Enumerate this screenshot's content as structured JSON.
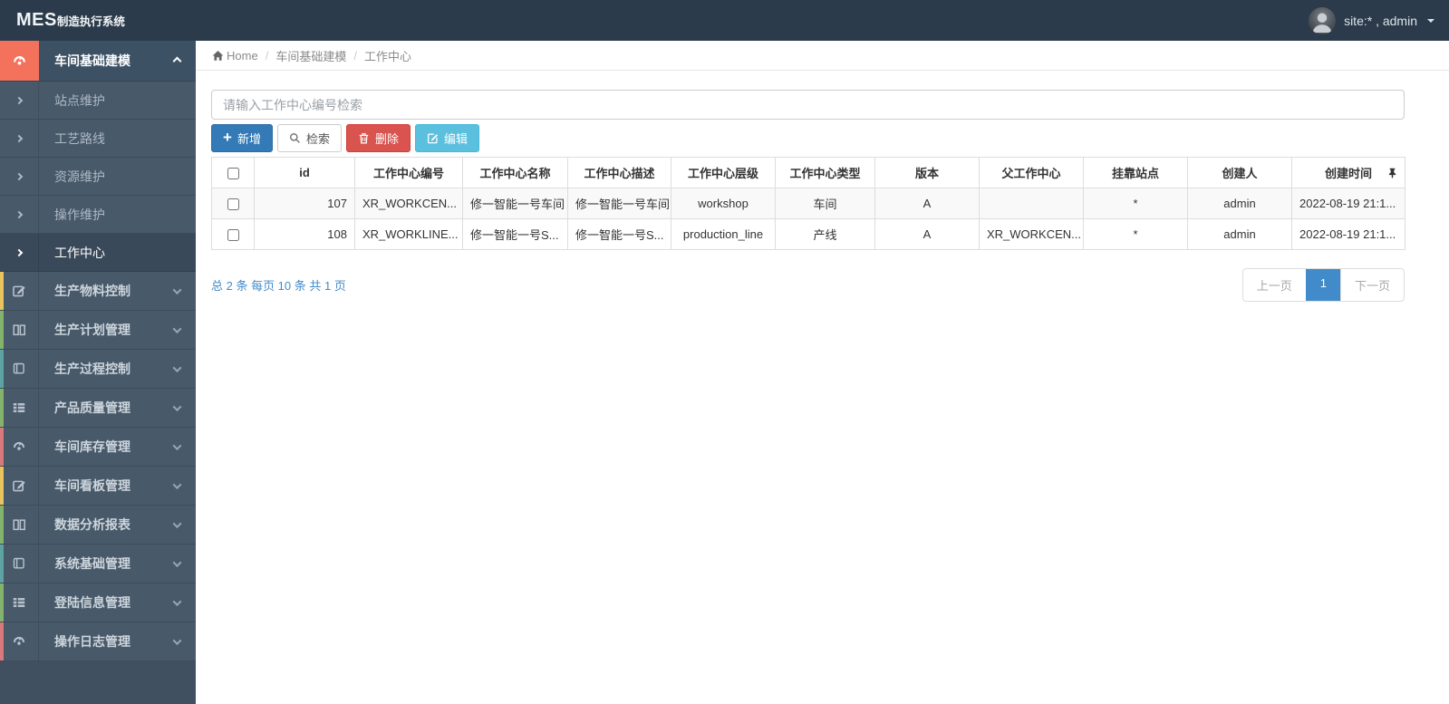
{
  "navbar": {
    "logo_strong": "MES",
    "logo_rest": "制造执行系统",
    "user_label": "site:* , admin"
  },
  "sidebar": {
    "active_parent": {
      "label": "车间基础建模"
    },
    "submenu": [
      {
        "label": "站点维护"
      },
      {
        "label": "工艺路线"
      },
      {
        "label": "资源维护"
      },
      {
        "label": "操作维护"
      },
      {
        "label": "工作中心"
      }
    ],
    "sections": [
      {
        "label": "生产物料控制"
      },
      {
        "label": "生产计划管理"
      },
      {
        "label": "生产过程控制"
      },
      {
        "label": "产品质量管理"
      },
      {
        "label": "车间库存管理"
      },
      {
        "label": "车间看板管理"
      },
      {
        "label": "数据分析报表"
      },
      {
        "label": "系统基础管理"
      },
      {
        "label": "登陆信息管理"
      },
      {
        "label": "操作日志管理"
      }
    ]
  },
  "breadcrumb": {
    "home": "Home",
    "level1": "车间基础建模",
    "level2": "工作中心"
  },
  "toolbar": {
    "search_placeholder": "请输入工作中心编号检索",
    "add_label": "新增",
    "search_label": "检索",
    "delete_label": "删除",
    "edit_label": "编辑"
  },
  "table": {
    "headers": [
      "id",
      "工作中心编号",
      "工作中心名称",
      "工作中心描述",
      "工作中心层级",
      "工作中心类型",
      "版本",
      "父工作中心",
      "挂靠站点",
      "创建人",
      "创建时间"
    ],
    "rows": [
      [
        "107",
        "XR_WORKCEN...",
        "修一智能一号车间",
        "修一智能一号车间",
        "workshop",
        "车间",
        "A",
        "",
        "*",
        "admin",
        "2022-08-19 21:1..."
      ],
      [
        "108",
        "XR_WORKLINE...",
        "修一智能一号S...",
        "修一智能一号S...",
        "production_line",
        "产线",
        "A",
        "XR_WORKCEN...",
        "*",
        "admin",
        "2022-08-19 21:1..."
      ]
    ]
  },
  "pagination": {
    "summary": "总 2 条  每页 10 条  共 1 页",
    "prev": "上一页",
    "current": "1",
    "next": "下一页"
  },
  "colors": {
    "navbar_bg": "#2b3b4b",
    "sidebar_bg": "#405061",
    "sidebar_item_bg": "#48596a",
    "sidebar_active_bg": "#3d5164",
    "submenu_active_bg": "#39495a",
    "active_icon_bg": "#f4715c",
    "strip_yellow": "#e9c35d",
    "strip_green": "#84b36d",
    "strip_teal": "#5ea3a3",
    "strip_red": "#d9797c",
    "btn_primary": "#337ab7",
    "btn_danger": "#d9534f",
    "btn_info": "#5bc0de",
    "link_blue": "#428bca",
    "page_active": "#428bca"
  }
}
